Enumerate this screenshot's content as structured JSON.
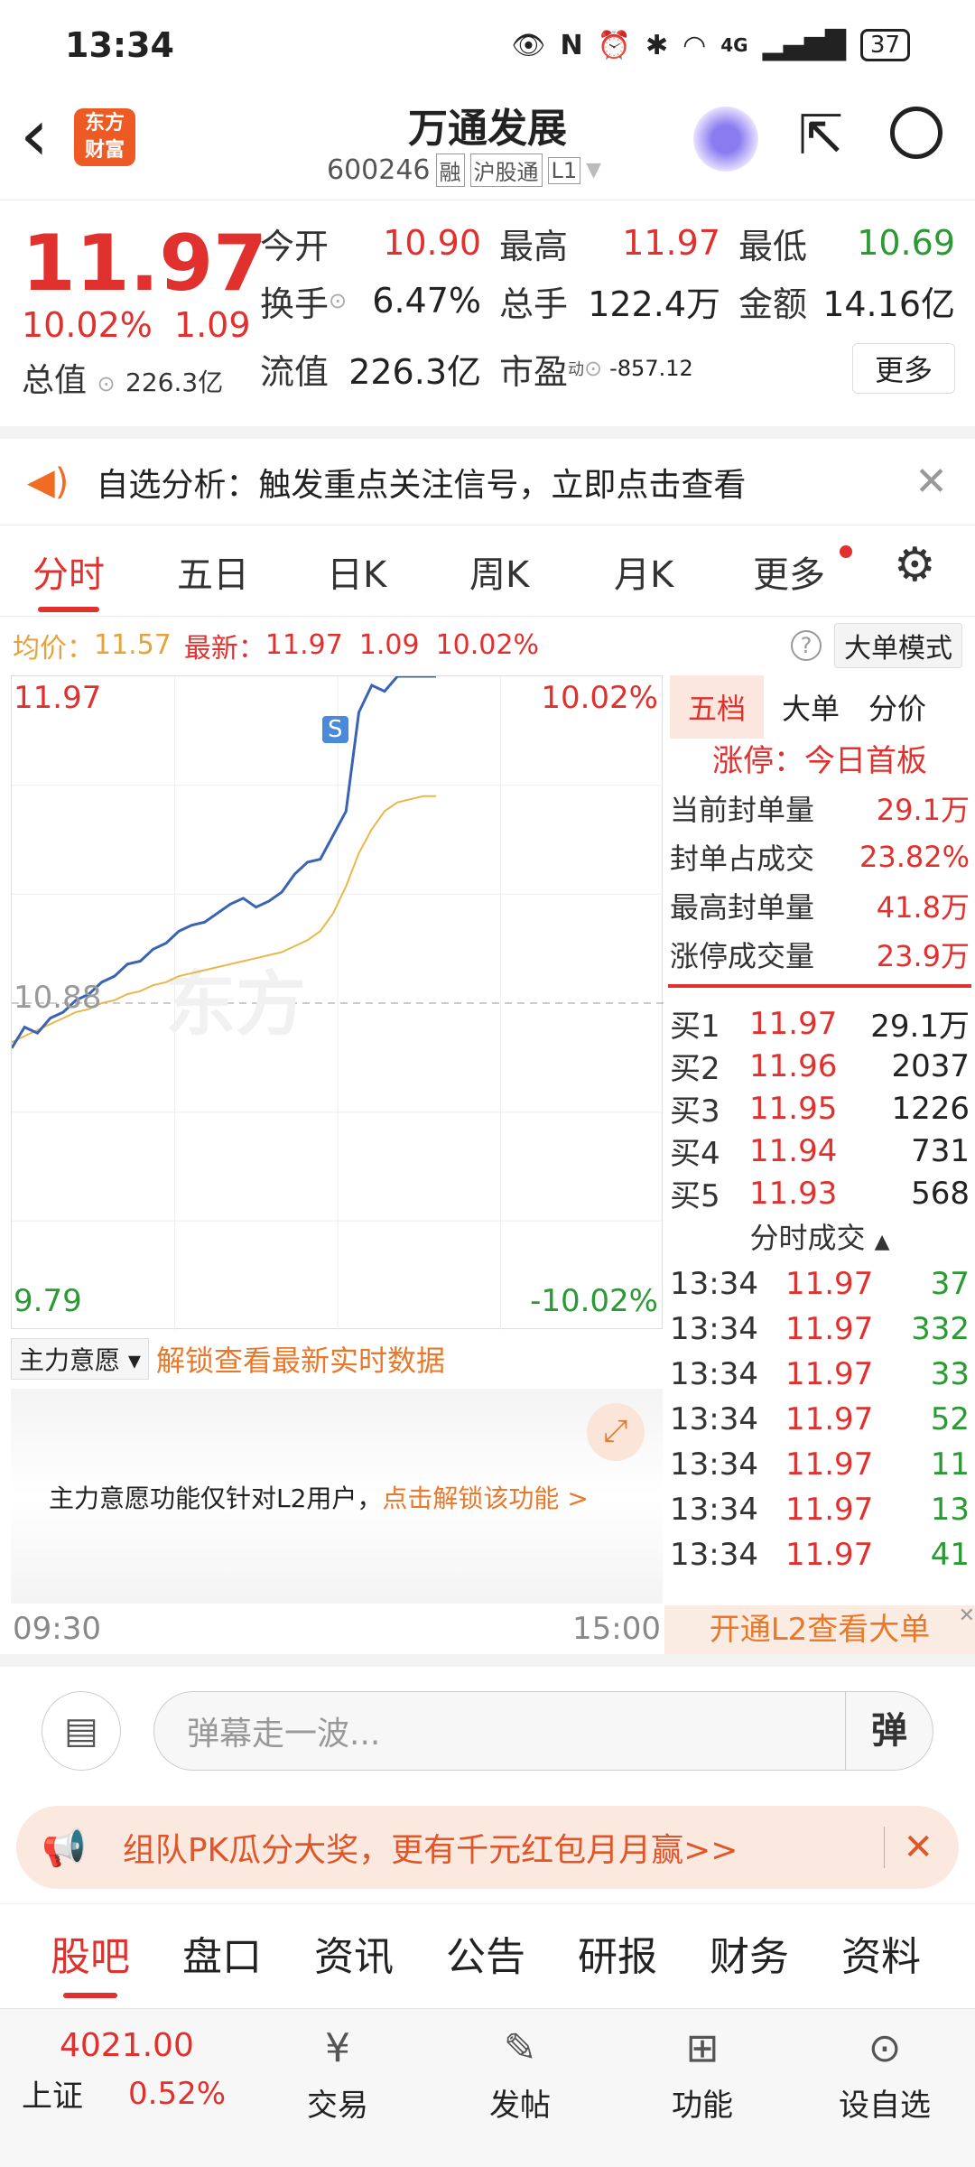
{
  "status": {
    "time": "13:34",
    "net": "4G",
    "battery": "37"
  },
  "header": {
    "back": "‹",
    "logo_l1": "东方",
    "logo_l2": "财富",
    "title": "万通发展",
    "code": "600246",
    "tags": [
      "融",
      "沪股通",
      "L1"
    ]
  },
  "quote": {
    "price": "11.97",
    "chg_pct": "10.02%",
    "chg": "1.09",
    "f": [
      {
        "k": "今开",
        "v": "10.90"
      },
      {
        "k": "最高",
        "v": "11.97"
      },
      {
        "k": "最低",
        "v": "10.69"
      },
      {
        "k": "换手",
        "v": "6.47%"
      },
      {
        "k": "总手",
        "v": "122.4万"
      },
      {
        "k": "金额",
        "v": "14.16亿"
      },
      {
        "k": "总值",
        "v": "226.3亿"
      },
      {
        "k": "流值",
        "v": "226.3亿"
      },
      {
        "k": "市盈",
        "sup": "动",
        "v": "-857.12"
      }
    ],
    "more": "更多"
  },
  "notice": {
    "text": "自选分析：触发重点关注信号，立即点击查看"
  },
  "tabs": [
    "分时",
    "五日",
    "日K",
    "周K",
    "月K",
    "更多"
  ],
  "info": {
    "avg_k": "均价：",
    "avg_v": "11.57",
    "last_k": "最新：",
    "last_v": "11.97",
    "chg": "1.09",
    "pct": "10.02%",
    "mode": "大单模式"
  },
  "chart_data": {
    "type": "line",
    "y_top": "11.97",
    "y_mid": "10.88",
    "y_bot": "9.79",
    "pct_top": "10.02%",
    "pct_bot": "-10.02%",
    "x_start": "09:30",
    "x_end": "15:00",
    "marker": "S",
    "ylim": [
      9.79,
      11.97
    ],
    "series": [
      {
        "values": [
          10.73,
          10.8,
          10.78,
          10.83,
          10.85,
          10.89,
          10.91,
          10.95,
          10.97,
          11.01,
          11.02,
          11.06,
          11.08,
          11.12,
          11.14,
          11.15,
          11.18,
          11.21,
          11.23,
          11.2,
          11.22,
          11.25,
          11.31,
          11.35,
          11.36,
          11.44,
          11.52,
          11.85,
          11.94,
          11.92,
          11.97,
          11.97,
          11.97,
          11.97
        ]
      },
      {
        "values": [
          10.75,
          10.77,
          10.79,
          10.81,
          10.83,
          10.85,
          10.86,
          10.88,
          10.89,
          10.91,
          10.92,
          10.94,
          10.95,
          10.97,
          10.98,
          10.99,
          11.0,
          11.01,
          11.02,
          11.03,
          11.04,
          11.05,
          11.07,
          11.09,
          11.12,
          11.18,
          11.27,
          11.38,
          11.46,
          11.52,
          11.55,
          11.56,
          11.57,
          11.57
        ]
      }
    ]
  },
  "orderbook": {
    "tabs": [
      "五档",
      "大单",
      "分价"
    ],
    "limit": "涨停：今日首板",
    "stats": [
      {
        "k": "当前封单量",
        "v": "29.1万"
      },
      {
        "k": "封单占成交",
        "v": "23.82%"
      },
      {
        "k": "最高封单量",
        "v": "41.8万"
      },
      {
        "k": "涨停成交量",
        "v": "23.9万"
      }
    ],
    "bids": [
      {
        "k": "买1",
        "p": "11.97",
        "q": "29.1万"
      },
      {
        "k": "买2",
        "p": "11.96",
        "q": "2037"
      },
      {
        "k": "买3",
        "p": "11.95",
        "q": "1226"
      },
      {
        "k": "买4",
        "p": "11.94",
        "q": "731"
      },
      {
        "k": "买5",
        "p": "11.93",
        "q": "568"
      }
    ],
    "ticks_title": "分时成交",
    "ticks": [
      {
        "t": "13:34",
        "p": "11.97",
        "q": "37"
      },
      {
        "t": "13:34",
        "p": "11.97",
        "q": "332"
      },
      {
        "t": "13:34",
        "p": "11.97",
        "q": "33"
      },
      {
        "t": "13:34",
        "p": "11.97",
        "q": "52"
      },
      {
        "t": "13:34",
        "p": "11.97",
        "q": "11"
      },
      {
        "t": "13:34",
        "p": "11.97",
        "q": "13"
      },
      {
        "t": "13:34",
        "p": "11.97",
        "q": "41"
      }
    ],
    "l2": "开通L2查看大单"
  },
  "main_force": {
    "label": "主力意愿",
    "unlock": "解锁查看最新实时数据",
    "msg": "主力意愿功能仅针对L2用户，",
    "link": "点击解锁该功能 >"
  },
  "barrage": {
    "placeholder": "弹幕走一波...",
    "btn": "弹"
  },
  "promo": {
    "text": "组队PK瓜分大奖，更有千元红包月月赢>>"
  },
  "bottom_tabs": [
    "股吧",
    "盘口",
    "资讯",
    "公告",
    "研报",
    "财务",
    "资料"
  ],
  "nav": {
    "index_val": "4021.00",
    "index_name": "上证",
    "index_pct": "0.52%",
    "items": [
      {
        "label": "交易"
      },
      {
        "label": "发帖"
      },
      {
        "label": "功能"
      },
      {
        "label": "设自选"
      }
    ]
  }
}
